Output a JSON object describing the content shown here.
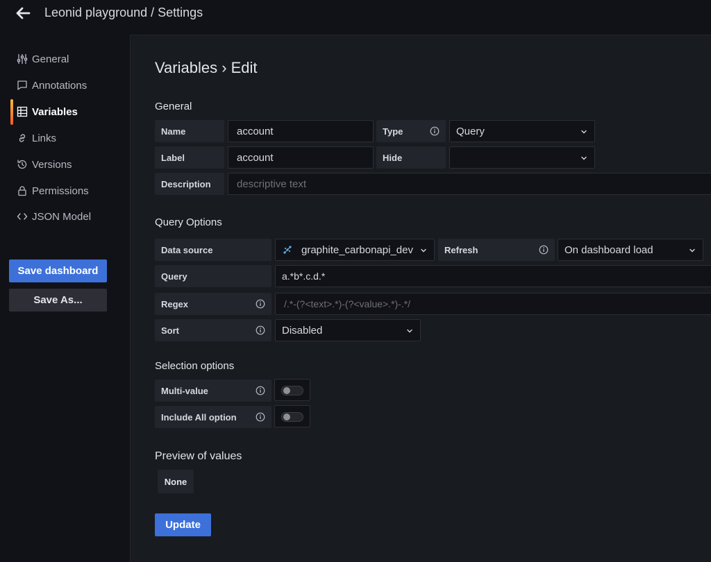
{
  "header": {
    "title": "Leonid playground / Settings"
  },
  "sidebar": {
    "items": [
      {
        "label": "General"
      },
      {
        "label": "Annotations"
      },
      {
        "label": "Variables"
      },
      {
        "label": "Links"
      },
      {
        "label": "Versions"
      },
      {
        "label": "Permissions"
      },
      {
        "label": "JSON Model"
      }
    ],
    "active_item": "Variables",
    "save_label": "Save dashboard",
    "save_as_label": "Save As..."
  },
  "page": {
    "title": "Variables › Edit"
  },
  "general": {
    "heading": "General",
    "name_label": "Name",
    "name_value": "account",
    "type_label": "Type",
    "type_value": "Query",
    "label_label": "Label",
    "label_value": "account",
    "hide_label": "Hide",
    "hide_value": "",
    "description_label": "Description",
    "description_placeholder": "descriptive text"
  },
  "query_options": {
    "heading": "Query Options",
    "datasource_label": "Data source",
    "datasource_value": "graphite_carbonapi_dev",
    "refresh_label": "Refresh",
    "refresh_value": "On dashboard load",
    "query_label": "Query",
    "query_value": "a.*b*.c.d.*",
    "regex_label": "Regex",
    "regex_placeholder": "/.*-(?<text>.*)-(?<value>.*)-.*/",
    "sort_label": "Sort",
    "sort_value": "Disabled"
  },
  "selection": {
    "heading": "Selection options",
    "multi_label": "Multi-value",
    "multi_enabled": false,
    "include_all_label": "Include All option",
    "include_all_enabled": false
  },
  "preview": {
    "heading": "Preview of values",
    "values": [
      "None"
    ]
  },
  "actions": {
    "update_label": "Update"
  },
  "colors": {
    "accent": "#3d71d9",
    "active_bar_top": "#f5b73b",
    "active_bar_bottom": "#f05a28"
  }
}
